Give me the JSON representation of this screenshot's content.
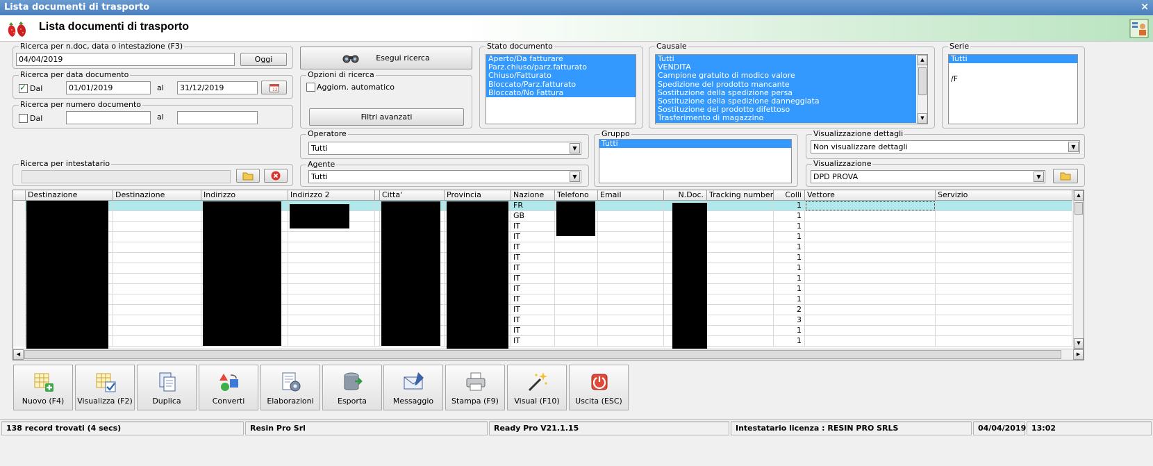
{
  "window": {
    "title": "Lista documenti di trasporto",
    "close_glyph": "×"
  },
  "header": {
    "title": "Lista documenti di trasporto"
  },
  "search_ndoc": {
    "legend": "Ricerca per n.doc, data o intestazione (F3)",
    "value": "04/04/2019",
    "today_button": "Oggi"
  },
  "search_date": {
    "legend": "Ricerca per data documento",
    "dal_label": "Dal",
    "dal_checked": true,
    "from": "01/01/2019",
    "al_label": "al",
    "to": "31/12/2019"
  },
  "search_number": {
    "legend": "Ricerca per numero documento",
    "dal_label": "Dal",
    "dal_checked": false,
    "from": "",
    "al_label": "al",
    "to": ""
  },
  "search_holder": {
    "legend": "Ricerca per intestatario",
    "value": ""
  },
  "execute_button": "Esegui ricerca",
  "search_options": {
    "legend": "Opzioni di ricerca",
    "auto_update": "Aggiorn. automatico",
    "advanced_filters": "Filtri avanzati"
  },
  "stato_documento": {
    "legend": "Stato documento",
    "items": [
      "Aperto/Da fatturare",
      "Parz.chiuso/parz.fatturato",
      "Chiuso/Fatturato",
      "Bloccato/Parz.fatturato",
      "Bloccato/No Fattura"
    ]
  },
  "causale": {
    "legend": "Causale",
    "items": [
      "Tutti",
      "VENDITA",
      "Campione gratuito di modico valore",
      "Spedizione del prodotto mancante",
      "Sostituzione della spedizione persa",
      "Sostituzione della spedizione danneggiata",
      "Sostituzione del prodotto difettoso",
      "Trasferimento di magazzino"
    ]
  },
  "serie": {
    "legend": "Serie",
    "items": [
      "Tutti",
      "",
      "/F"
    ]
  },
  "operatore": {
    "legend": "Operatore",
    "value": "Tutti"
  },
  "agente": {
    "legend": "Agente",
    "value": "Tutti"
  },
  "gruppo": {
    "legend": "Gruppo",
    "items": [
      "Tutti"
    ]
  },
  "dettagli": {
    "legend": "Visualizzazione dettagli",
    "value": "Non visualizzare dettagli"
  },
  "visualizzazione": {
    "legend": "Visualizzazione",
    "value": "DPD PROVA"
  },
  "grid": {
    "columns": [
      "Destinazione",
      "Destinazione",
      "Indirizzo",
      "Indirizzo 2",
      "",
      "Citta'",
      "Provincia",
      "Nazione",
      "Telefono",
      "Email",
      "N.Doc.",
      "Tracking number",
      "Colli",
      "Vettore",
      "Servizio"
    ],
    "rows": [
      {
        "nazione": "FR",
        "colli": "1"
      },
      {
        "nazione": "GB",
        "colli": "1"
      },
      {
        "nazione": "IT",
        "colli": "1"
      },
      {
        "nazione": "IT",
        "colli": "1"
      },
      {
        "nazione": "IT",
        "colli": "1"
      },
      {
        "nazione": "IT",
        "colli": "1"
      },
      {
        "nazione": "IT",
        "colli": "1"
      },
      {
        "nazione": "IT",
        "colli": "1"
      },
      {
        "nazione": "IT",
        "colli": "1"
      },
      {
        "nazione": "IT",
        "colli": "1"
      },
      {
        "nazione": "IT",
        "colli": "2"
      },
      {
        "nazione": "IT",
        "colli": "3"
      },
      {
        "nazione": "IT",
        "colli": "1"
      },
      {
        "nazione": "IT",
        "colli": "1"
      }
    ]
  },
  "toolbar": [
    {
      "label": "Nuovo (F4)",
      "icon": "new-document-icon"
    },
    {
      "label": "Visualizza (F2)",
      "icon": "view-document-icon"
    },
    {
      "label": "Duplica",
      "icon": "duplicate-icon"
    },
    {
      "label": "Converti",
      "icon": "convert-icon"
    },
    {
      "label": "Elaborazioni",
      "icon": "processing-icon"
    },
    {
      "label": "Esporta",
      "icon": "export-database-icon"
    },
    {
      "label": "Messaggio",
      "icon": "message-envelope-icon"
    },
    {
      "label": "Stampa (F9)",
      "icon": "printer-icon"
    },
    {
      "label": "Visual (F10)",
      "icon": "magic-wand-icon"
    },
    {
      "label": "Uscita (ESC)",
      "icon": "exit-icon"
    }
  ],
  "status": {
    "records": "138 record trovati (4 secs)",
    "company": "Resin Pro Srl",
    "version": "Ready Pro V21.1.15",
    "license": "Intestatario licenza : RESIN PRO SRLS",
    "date": "04/04/2019",
    "time": "13:02"
  },
  "colors": {
    "selection": "#3399ff",
    "row_selected": "#b0e8ec",
    "title_bar": "#4a7fbd"
  }
}
